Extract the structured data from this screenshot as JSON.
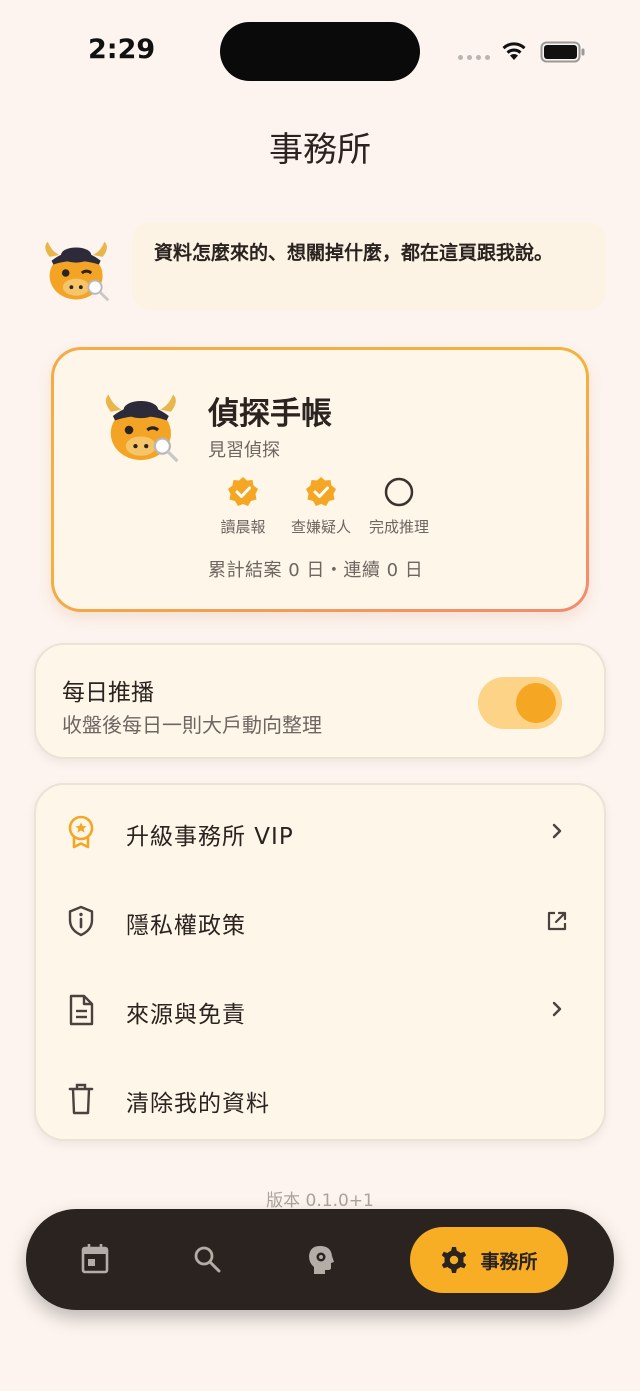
{
  "status_bar": {
    "time": "2:29"
  },
  "header": {
    "title": "事務所"
  },
  "bubble": {
    "text": "資料怎麼來的、想關掉什麼，都在這頁跟我說。"
  },
  "profile_card": {
    "title": "偵探手帳",
    "subtitle": "見習偵探",
    "badges": [
      {
        "label": "讀晨報",
        "done": true
      },
      {
        "label": "查嫌疑人",
        "done": true
      },
      {
        "label": "完成推理",
        "done": false
      }
    ],
    "stats": "累計結案 0 日・連續 0 日"
  },
  "push": {
    "title": "每日推播",
    "subtitle": "收盤後每日一則大戶動向整理",
    "enabled": true
  },
  "menu": {
    "items": [
      {
        "label": "升級事務所 VIP",
        "icon": "award-icon",
        "trail": "chevron-right-icon"
      },
      {
        "label": "隱私權政策",
        "icon": "shield-info-icon",
        "trail": "external-link-icon"
      },
      {
        "label": "來源與免責",
        "icon": "document-icon",
        "trail": "chevron-right-icon"
      },
      {
        "label": "清除我的資料",
        "icon": "trash-icon",
        "trail": ""
      }
    ]
  },
  "version": "版本 0.1.0+1",
  "bottom_nav": {
    "items": [
      {
        "icon": "calendar-icon"
      },
      {
        "icon": "search-icon"
      },
      {
        "icon": "head-gear-icon"
      },
      {
        "icon": "gear-icon",
        "label": "事務所",
        "active": true
      }
    ]
  },
  "colors": {
    "background": "#fdf4ef",
    "accent": "#f7ad24",
    "card": "#fdf6e9",
    "nav": "#2a231f"
  }
}
